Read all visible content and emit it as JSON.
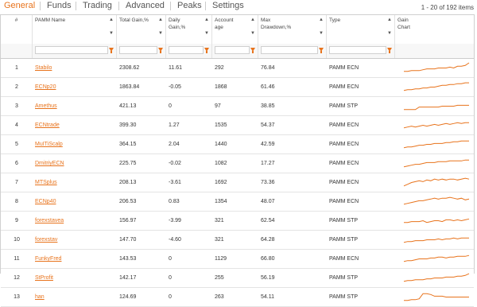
{
  "tabs": [
    {
      "label": "General",
      "active": true
    },
    {
      "label": "Funds",
      "active": false
    },
    {
      "label": "Trading",
      "active": false
    },
    {
      "label": "Advanced",
      "active": false
    },
    {
      "label": "Peaks",
      "active": false
    },
    {
      "label": "Settings",
      "active": false
    }
  ],
  "paging": "1 - 20 of 192 items",
  "accent": "#e8731c",
  "columns": {
    "num": "#",
    "name": "PAMM Name",
    "gain": "Total Gain,%",
    "daily": "Daily Gain,%",
    "age": "Account age",
    "dd": "Max Drawdown,%",
    "type": "Type",
    "chart": "Gain Chart"
  },
  "rows": [
    {
      "n": "1",
      "name": "Stabilo",
      "gain": "2308.62",
      "daily": "11.61",
      "age": "292",
      "dd": "76.84",
      "type": "PAMM ECN",
      "spark": [
        2,
        2,
        3,
        3,
        3,
        4,
        5,
        5,
        5,
        6,
        6,
        6,
        7,
        6,
        8,
        8,
        9,
        12
      ]
    },
    {
      "n": "2",
      "name": "ECNp20",
      "gain": "1863.84",
      "daily": "-0.05",
      "age": "1868",
      "dd": "61.46",
      "type": "PAMM ECN",
      "spark": [
        2,
        3,
        3,
        4,
        4,
        5,
        5,
        6,
        6,
        7,
        8,
        8,
        9,
        9,
        10,
        10,
        11,
        11
      ]
    },
    {
      "n": "3",
      "name": "Amethus",
      "gain": "421.13",
      "daily": "0",
      "age": "97",
      "dd": "38.85",
      "type": "PAMM STP",
      "spark": [
        2,
        2,
        2,
        2,
        5,
        5,
        5,
        5,
        5,
        5,
        6,
        6,
        6,
        6,
        7,
        7,
        7,
        7
      ]
    },
    {
      "n": "4",
      "name": "ECNtrade",
      "gain": "399.30",
      "daily": "1.27",
      "age": "1535",
      "dd": "54.37",
      "type": "PAMM ECN",
      "spark": [
        3,
        4,
        5,
        4,
        5,
        6,
        5,
        6,
        7,
        6,
        7,
        8,
        7,
        8,
        9,
        8,
        9,
        9
      ]
    },
    {
      "n": "5",
      "name": "MuITiScalp",
      "gain": "364.15",
      "daily": "2.04",
      "age": "1440",
      "dd": "42.59",
      "type": "PAMM ECN",
      "spark": [
        2,
        3,
        3,
        4,
        5,
        5,
        6,
        6,
        7,
        7,
        7,
        8,
        8,
        9,
        9,
        10,
        10,
        10
      ]
    },
    {
      "n": "6",
      "name": "DmitriyECN",
      "gain": "225.75",
      "daily": "-0.02",
      "age": "1082",
      "dd": "17.27",
      "type": "PAMM ECN",
      "spark": [
        2,
        3,
        4,
        5,
        5,
        6,
        7,
        7,
        7,
        8,
        8,
        8,
        9,
        9,
        9,
        9,
        10,
        10
      ]
    },
    {
      "n": "7",
      "name": "MTSplus",
      "gain": "208.13",
      "daily": "-3.61",
      "age": "1692",
      "dd": "73.36",
      "type": "PAMM ECN",
      "spark": [
        2,
        4,
        6,
        7,
        8,
        7,
        9,
        8,
        10,
        9,
        10,
        9,
        10,
        10,
        9,
        10,
        11,
        10
      ]
    },
    {
      "n": "8",
      "name": "ECNp40",
      "gain": "206.53",
      "daily": "0.83",
      "age": "1354",
      "dd": "48.07",
      "type": "PAMM ECN",
      "spark": [
        3,
        4,
        5,
        6,
        7,
        7,
        8,
        9,
        10,
        9,
        10,
        10,
        11,
        10,
        9,
        10,
        8,
        9
      ]
    },
    {
      "n": "9",
      "name": "forexstavea",
      "gain": "156.97",
      "daily": "-3.99",
      "age": "321",
      "dd": "62.54",
      "type": "PAMM STP",
      "spark": [
        4,
        4,
        5,
        5,
        5,
        6,
        4,
        5,
        6,
        6,
        5,
        7,
        7,
        6,
        7,
        6,
        7,
        8
      ]
    },
    {
      "n": "10",
      "name": "forexstav",
      "gain": "147.70",
      "daily": "-4.60",
      "age": "321",
      "dd": "64.28",
      "type": "PAMM STP",
      "spark": [
        3,
        4,
        4,
        5,
        5,
        5,
        6,
        6,
        6,
        7,
        6,
        7,
        7,
        8,
        7,
        8,
        8,
        8
      ]
    },
    {
      "n": "11",
      "name": "FunkyFred",
      "gain": "143.53",
      "daily": "0",
      "age": "1129",
      "dd": "66.80",
      "type": "PAMM ECN",
      "spark": [
        3,
        4,
        4,
        5,
        6,
        6,
        6,
        7,
        7,
        8,
        8,
        7,
        8,
        8,
        9,
        9,
        9,
        10
      ]
    },
    {
      "n": "12",
      "name": "StProfit",
      "gain": "142.17",
      "daily": "0",
      "age": "255",
      "dd": "56.19",
      "type": "PAMM STP",
      "spark": [
        2,
        3,
        3,
        4,
        4,
        4,
        5,
        5,
        6,
        6,
        6,
        7,
        7,
        7,
        8,
        8,
        9,
        11
      ]
    },
    {
      "n": "13",
      "name": "han",
      "gain": "124.69",
      "daily": "0",
      "age": "263",
      "dd": "54.11",
      "type": "PAMM STP",
      "spark": [
        2,
        2,
        3,
        3,
        4,
        10,
        10,
        9,
        7,
        7,
        7,
        6,
        6,
        6,
        6,
        6,
        6,
        6
      ]
    }
  ]
}
